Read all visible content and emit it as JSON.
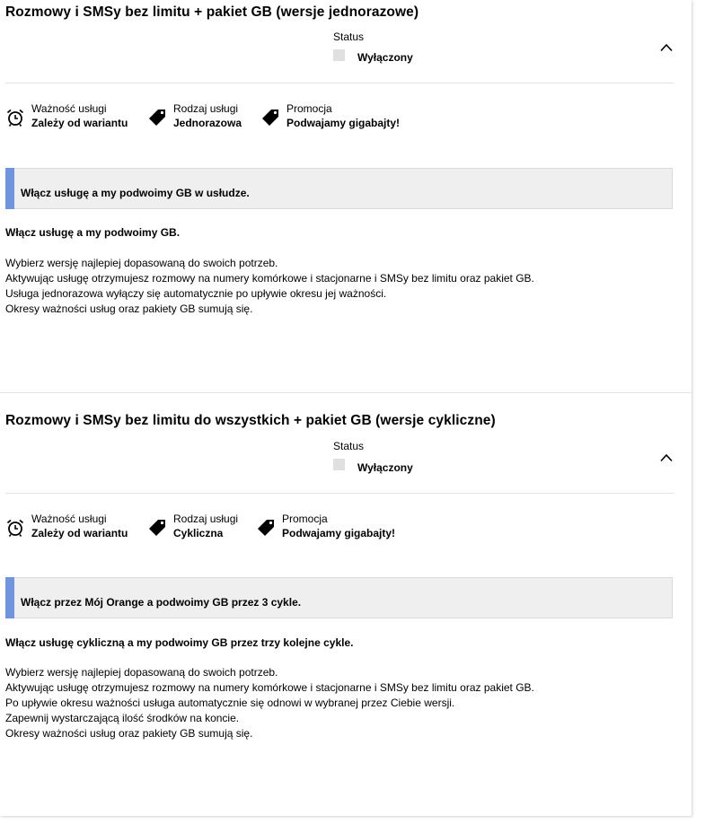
{
  "cards": [
    {
      "title": "Rozmowy i SMSy bez limitu + pakiet GB (wersje jednorazowe)",
      "status_label": "Status",
      "status_value": "Wyłączony",
      "info": [
        {
          "label": "Ważność usługi",
          "value": "Zależy od wariantu",
          "icon": "alarm-clock-icon"
        },
        {
          "label": "Rodzaj usługi",
          "value": "Jednorazowa",
          "icon": "tag-icon"
        },
        {
          "label": "Promocja",
          "value": "Podwajamy gigabajty!",
          "icon": "tag-icon"
        }
      ],
      "banner": "Włącz usługę a my podwoimy GB w usłudze.",
      "headline": "Włącz usługę a my podwoimy GB.",
      "description": [
        "Wybierz wersję najlepiej dopasowaną do swoich potrzeb.",
        "Aktywując usługę otrzymujesz rozmowy na numery komórkowe i stacjonarne i SMSy bez limitu oraz pakiet GB.",
        "Usługa jednorazowa wyłączy się automatycznie po upływie okresu jej ważności.",
        "Okresy ważności usług oraz pakiety GB sumują się."
      ]
    },
    {
      "title": "Rozmowy i SMSy bez limitu do wszystkich + pakiet GB (wersje cykliczne)",
      "status_label": "Status",
      "status_value": "Wyłączony",
      "info": [
        {
          "label": "Ważność usługi",
          "value": "Zależy od wariantu",
          "icon": "alarm-clock-icon"
        },
        {
          "label": "Rodzaj usługi",
          "value": "Cykliczna",
          "icon": "tag-icon"
        },
        {
          "label": "Promocja",
          "value": "Podwajamy gigabajty!",
          "icon": "tag-icon"
        }
      ],
      "banner": "Włącz przez Mój Orange a podwoimy GB przez 3 cykle.",
      "headline": "Włącz usługę cykliczną a my podwoimy GB przez trzy kolejne cykle.",
      "description": [
        "Wybierz wersję najlepiej dopasowaną do swoich potrzeb.",
        "Aktywując usługę otrzymujesz rozmowy na numery komórkowe i stacjonarne i SMSy bez limitu oraz pakiet GB.",
        "Po upływie okresu ważności usługa automatycznie się odnowi w wybranej przez Ciebie wersji.",
        "Zapewnij wystarczającą ilość środków na koncie.",
        "Okresy ważności usług oraz pakiety GB sumują się."
      ]
    }
  ],
  "colors": {
    "accent_bar": "#6e95de",
    "banner_bg": "#efefef"
  }
}
